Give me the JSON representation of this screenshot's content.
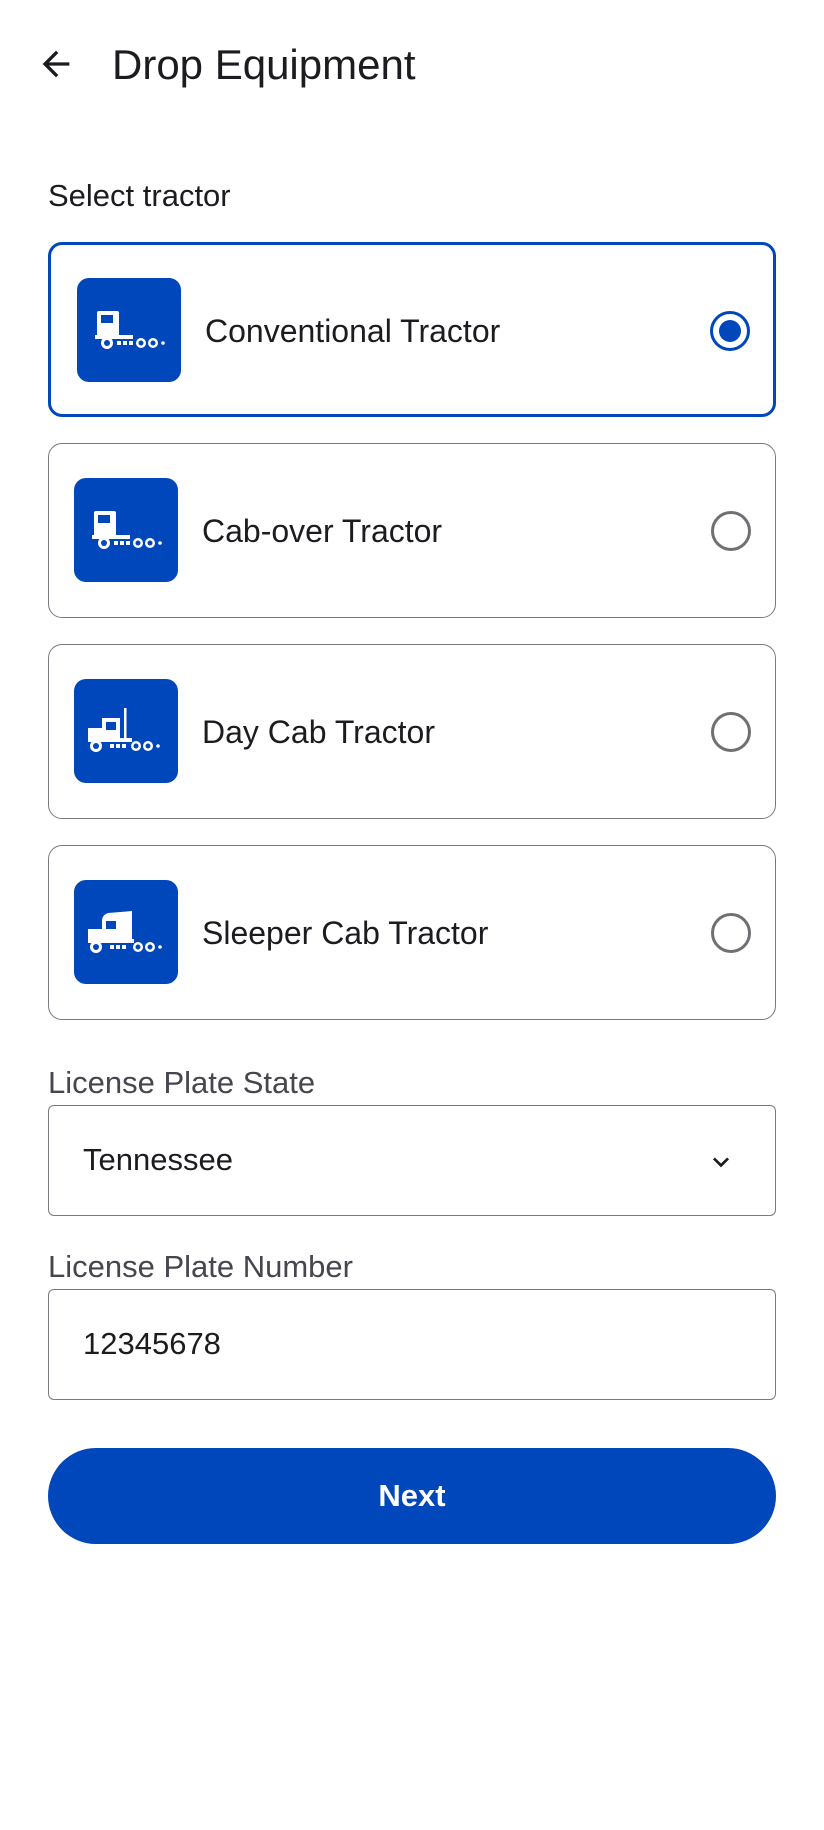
{
  "header": {
    "title": "Drop Equipment",
    "back_icon": "arrow-left-icon"
  },
  "tractor_section": {
    "label": "Select tractor",
    "options": [
      {
        "label": "Conventional Tractor",
        "icon": "conventional-tractor-icon",
        "selected": true
      },
      {
        "label": "Cab-over Tractor",
        "icon": "cab-over-tractor-icon",
        "selected": false
      },
      {
        "label": "Day Cab Tractor",
        "icon": "day-cab-tractor-icon",
        "selected": false
      },
      {
        "label": "Sleeper Cab Tractor",
        "icon": "sleeper-cab-tractor-icon",
        "selected": false
      }
    ]
  },
  "license_state": {
    "label": "License Plate State",
    "value": "Tennessee"
  },
  "license_number": {
    "label": "License Plate Number",
    "value": "12345678"
  },
  "next_button": {
    "label": "Next"
  },
  "colors": {
    "accent": "#0047bb",
    "border": "#7a7a80",
    "text": "#1c1b1f",
    "label": "#45464f"
  }
}
